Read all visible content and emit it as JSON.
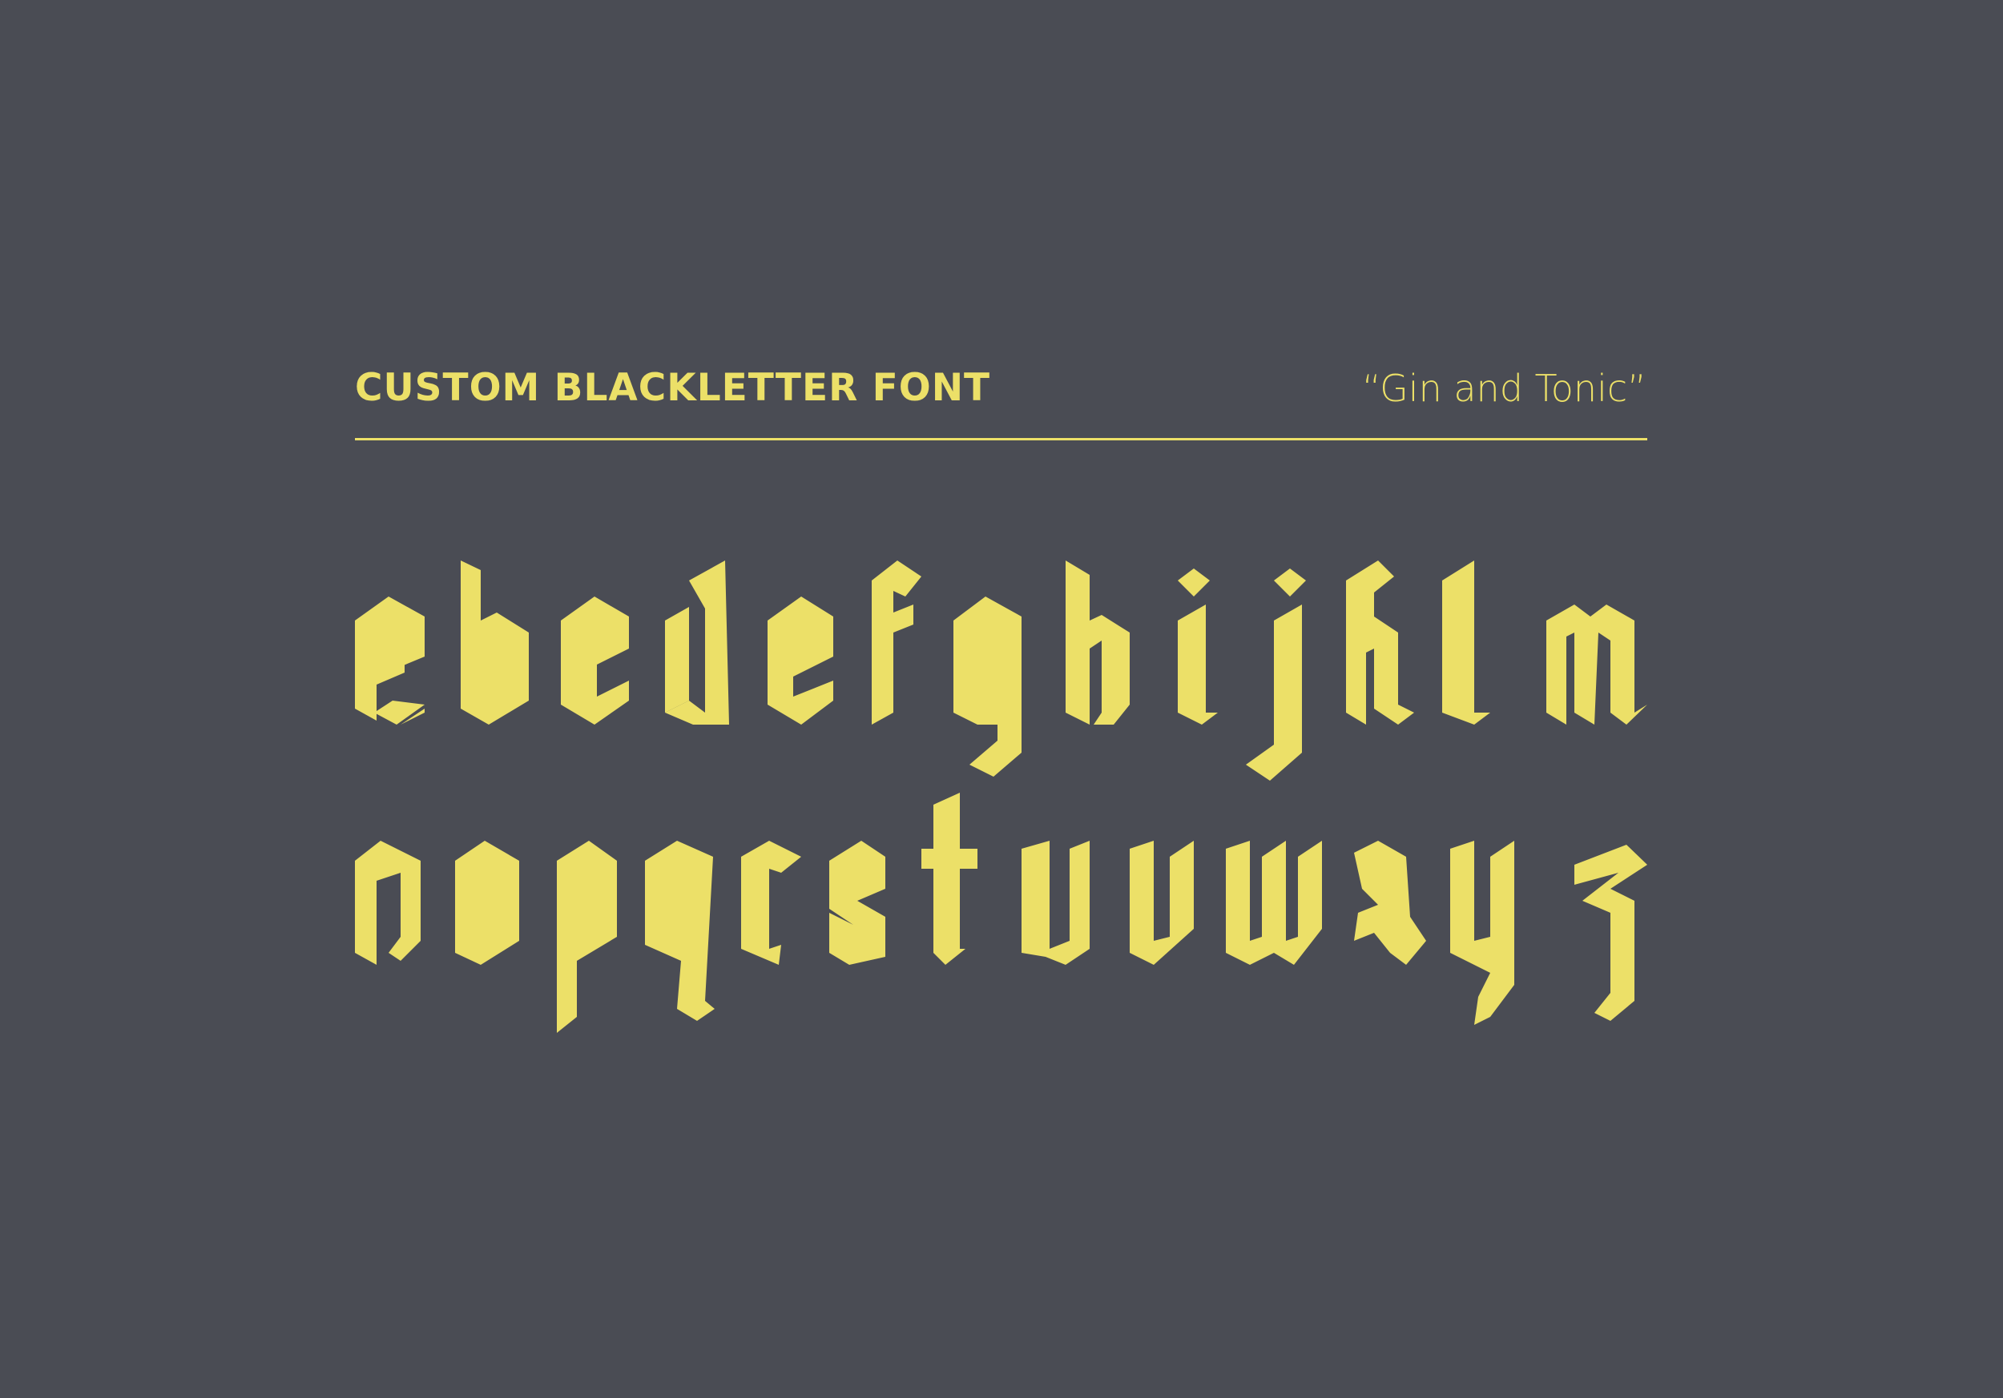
{
  "header": {
    "title": "CUSTOM BLACKLETTER FONT",
    "subtitle": "“Gin and Tonic”"
  },
  "specimen": {
    "row1": [
      "a",
      "b",
      "c",
      "d",
      "e",
      "f",
      "g",
      "h",
      "i",
      "j",
      "k",
      "l",
      "m"
    ],
    "row2": [
      "n",
      "o",
      "p",
      "q",
      "r",
      "s",
      "t",
      "u",
      "v",
      "w",
      "x",
      "y",
      "z"
    ]
  },
  "colors": {
    "background": "#4a4c54",
    "accent": "#ece068"
  }
}
